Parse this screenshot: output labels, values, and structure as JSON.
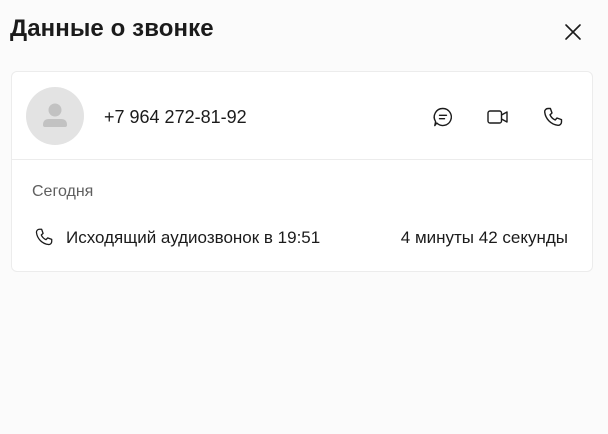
{
  "dialog": {
    "title": "Данные о звонке",
    "close_icon": "close-icon"
  },
  "contact": {
    "phone": "+7 964 272-81-92",
    "avatar_icon": "person-placeholder-icon",
    "actions": [
      {
        "icon": "chat-icon"
      },
      {
        "icon": "video-call-icon"
      },
      {
        "icon": "phone-icon"
      }
    ]
  },
  "history": {
    "date_label": "Сегодня",
    "calls": [
      {
        "icon": "phone-icon",
        "description": "Исходящий аудиозвонок в 19:51",
        "duration": "4 минуты 42 секунды"
      }
    ]
  },
  "colors": {
    "background": "#fbfbfb",
    "card": "#ffffff",
    "avatar_bg": "#e3e3e3",
    "avatar_fg": "#c2c2c2",
    "text": "#1b1b1b",
    "secondary_text": "#5f5f5f"
  }
}
